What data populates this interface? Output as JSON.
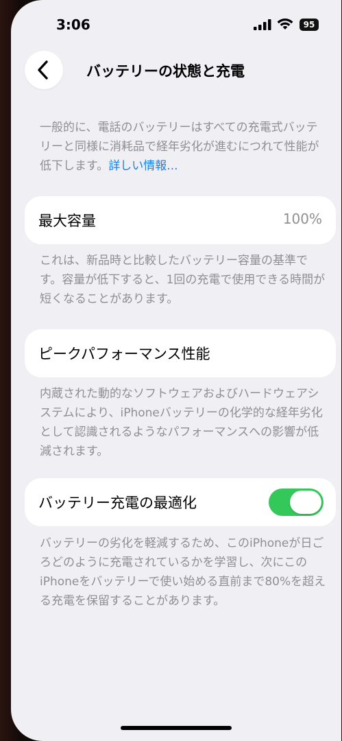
{
  "status_bar": {
    "time": "3:06",
    "battery_level": "95"
  },
  "nav": {
    "back_icon": "chevron-left-icon",
    "title": "バッテリーの状態と充電"
  },
  "intro": {
    "text": "一般的に、電話のバッテリーはすべての充電式バッテリーと同様に消耗品で経年劣化が進むにつれて性能が低下します。",
    "link_text": "詳しい情報..."
  },
  "max_capacity": {
    "label": "最大容量",
    "value": "100%",
    "description": "これは、新品時と比較したバッテリー容量の基準です。容量が低下すると、1回の充電で使用できる時間が短くなることがあります。"
  },
  "peak_performance": {
    "label": "ピークパフォーマンス性能",
    "description": "内蔵された動的なソフトウェアおよびハードウェアシステムにより、iPhoneバッテリーの化学的な経年劣化として認識されるようなパフォーマンスへの影響が低減されます。"
  },
  "optimized_charging": {
    "label": "バッテリー充電の最適化",
    "enabled": true,
    "description": "バッテリーの劣化を軽減するため、このiPhoneが日ごろどのように充電されているかを学習し、次にこのiPhoneをバッテリーで使い始める直前まで80%を超える充電を保留することがあります。"
  },
  "colors": {
    "background": "#efeff4",
    "card": "#ffffff",
    "secondary_text": "#8e8e93",
    "link": "#1f7fe5",
    "toggle_on": "#34c759"
  }
}
